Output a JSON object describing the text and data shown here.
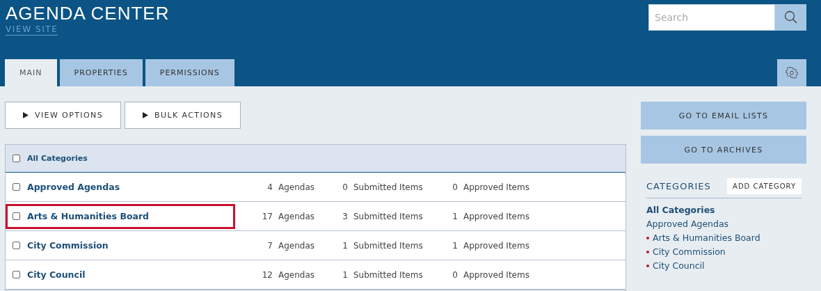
{
  "header": {
    "title": "AGENDA CENTER",
    "link": "VIEW SITE",
    "search": {
      "placeholder": "Search"
    }
  },
  "tabs": [
    {
      "label": "MAIN",
      "selected": true
    },
    {
      "label": "PROPERTIES",
      "selected": false
    },
    {
      "label": "PERMISSIONS",
      "selected": false
    }
  ],
  "actions": [
    "VIEW OPTIONS",
    "BULK ACTIONS"
  ],
  "table": {
    "header": {
      "label": "All Categories",
      "checked": false
    },
    "rows": [
      {
        "name": "Approved Agendas",
        "checked": false,
        "highlighted": false,
        "agendas": "4",
        "agendas_label": "Agendas",
        "submitted": "0",
        "submitted_label": "Submitted Items",
        "approved": "0",
        "approved_label": "Approved Items"
      },
      {
        "name": "Arts & Humanities Board",
        "checked": false,
        "highlighted": true,
        "agendas": "17",
        "agendas_label": "Agendas",
        "submitted": "3",
        "submitted_label": "Submitted Items",
        "approved": "1",
        "approved_label": "Approved Items"
      },
      {
        "name": "City Commission",
        "checked": false,
        "highlighted": false,
        "agendas": "7",
        "agendas_label": "Agendas",
        "submitted": "1",
        "submitted_label": "Submitted Items",
        "approved": "1",
        "approved_label": "Approved Items"
      },
      {
        "name": "City Council",
        "checked": false,
        "highlighted": false,
        "agendas": "12",
        "agendas_label": "Agendas",
        "submitted": "1",
        "submitted_label": "Submitted Items",
        "approved": "0",
        "approved_label": "Approved Items"
      }
    ]
  },
  "sidebar": {
    "buttons": [
      "GO TO EMAIL LISTS",
      "GO TO ARCHIVES"
    ],
    "heading": "CATEGORIES",
    "add_button": "ADD CATEGORY",
    "items": [
      {
        "label": "All Categories",
        "selected": true,
        "bulleted": false
      },
      {
        "label": "Approved Agendas",
        "selected": false,
        "bulleted": false
      },
      {
        "label": "Arts & Humanities Board",
        "selected": false,
        "bulleted": true
      },
      {
        "label": "City Commission",
        "selected": false,
        "bulleted": true
      },
      {
        "label": "City Council",
        "selected": false,
        "bulleted": true
      }
    ]
  }
}
